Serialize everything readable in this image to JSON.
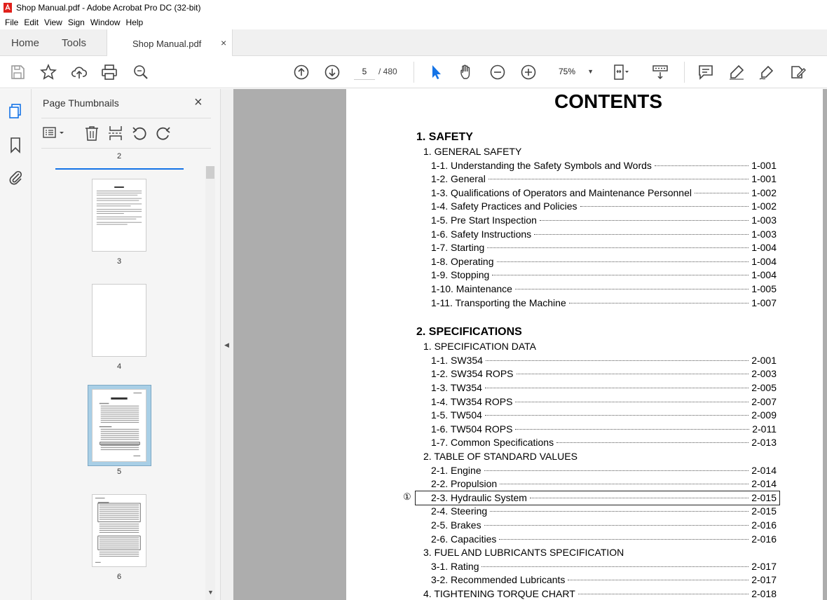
{
  "window": {
    "title": "Shop Manual.pdf - Adobe Acrobat Pro DC (32-bit)"
  },
  "menu": [
    "File",
    "Edit",
    "View",
    "Sign",
    "Window",
    "Help"
  ],
  "tabs": {
    "home": "Home",
    "tools": "Tools",
    "doc": "Shop Manual.pdf",
    "close": "×"
  },
  "toolbar": {
    "page_current": "5",
    "page_total": "/ 480",
    "zoom": "75%"
  },
  "thumbnails": {
    "title": "Page Thumbnails",
    "close": "×",
    "labels": [
      "2",
      "3",
      "4",
      "5",
      "6"
    ],
    "selected_page": "5"
  },
  "document": {
    "title": "CONTENTS",
    "sections": [
      {
        "heading": "1. SAFETY",
        "groups": [
          {
            "title": "1. GENERAL SAFETY",
            "entries": [
              {
                "label": "1-1. Understanding the Safety Symbols and Words",
                "page": "1-001"
              },
              {
                "label": "1-2. General",
                "page": "1-001"
              },
              {
                "label": "1-3. Qualifications of Operators and Maintenance Personnel",
                "page": "1-002"
              },
              {
                "label": "1-4. Safety Practices and Policies",
                "page": "1-002"
              },
              {
                "label": "1-5. Pre Start Inspection",
                "page": "1-003"
              },
              {
                "label": "1-6. Safety Instructions",
                "page": "1-003"
              },
              {
                "label": "1-7. Starting",
                "page": "1-004"
              },
              {
                "label": "1-8. Operating",
                "page": "1-004"
              },
              {
                "label": "1-9. Stopping",
                "page": "1-004"
              },
              {
                "label": "1-10. Maintenance",
                "page": "1-005"
              },
              {
                "label": "1-11. Transporting the Machine",
                "page": "1-007"
              }
            ]
          }
        ]
      },
      {
        "heading": "2. SPECIFICATIONS",
        "groups": [
          {
            "title": "1. SPECIFICATION DATA",
            "entries": [
              {
                "label": "1-1. SW354",
                "page": "2-001"
              },
              {
                "label": "1-2. SW354 ROPS",
                "page": "2-003"
              },
              {
                "label": "1-3. TW354",
                "page": "2-005"
              },
              {
                "label": "1-4. TW354 ROPS",
                "page": "2-007"
              },
              {
                "label": "1-5. TW504",
                "page": "2-009"
              },
              {
                "label": "1-6. TW504 ROPS",
                "page": "2-011"
              },
              {
                "label": "1-7. Common Specifications",
                "page": "2-013"
              }
            ]
          },
          {
            "title": "2. TABLE OF STANDARD VALUES",
            "entries": [
              {
                "label": "2-1. Engine",
                "page": "2-014"
              },
              {
                "label": "2-2. Propulsion",
                "page": "2-014"
              },
              {
                "label": "2-3. Hydraulic System",
                "page": "2-015"
              },
              {
                "label": "2-4. Steering",
                "page": "2-015"
              },
              {
                "label": "2-5. Brakes",
                "page": "2-016"
              },
              {
                "label": "2-6. Capacities",
                "page": "2-016"
              }
            ]
          },
          {
            "title": "3. FUEL AND LUBRICANTS SPECIFICATION",
            "entries": [
              {
                "label": "3-1. Rating",
                "page": "2-017"
              },
              {
                "label": "3-2. Recommended Lubricants",
                "page": "2-017"
              }
            ]
          },
          {
            "title": "4. TIGHTENING TORQUE CHART",
            "page": "2-018",
            "entries": []
          }
        ]
      }
    ],
    "marker": "①"
  }
}
